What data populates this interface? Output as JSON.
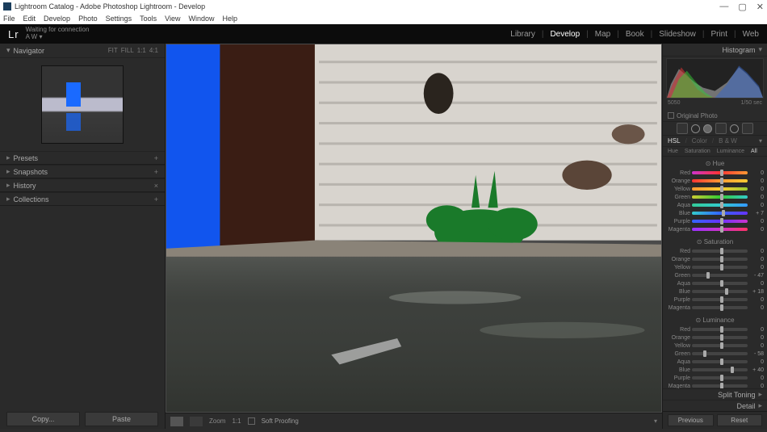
{
  "titlebar": {
    "title": "Lightroom Catalog - Adobe Photoshop Lightroom - Develop"
  },
  "menubar": [
    "File",
    "Edit",
    "Develop",
    "Photo",
    "Settings",
    "Tools",
    "View",
    "Window",
    "Help"
  ],
  "header": {
    "lr": "Lr",
    "status": "Waiting for connection",
    "user": "A W ▾",
    "modules": [
      "Library",
      "Develop",
      "Map",
      "Book",
      "Slideshow",
      "Print",
      "Web"
    ],
    "active": "Develop"
  },
  "left": {
    "navigator": {
      "label": "Navigator",
      "fit": "FIT",
      "fill": "FILL",
      "z1": "1:1",
      "z2": "4:1"
    },
    "panels": [
      {
        "label": "Presets",
        "icon": "+"
      },
      {
        "label": "Snapshots",
        "icon": "+"
      },
      {
        "label": "History",
        "icon": "×"
      },
      {
        "label": "Collections",
        "icon": "+"
      }
    ],
    "copy": "Copy...",
    "paste": "Paste"
  },
  "center": {
    "zoom_label": "Zoom",
    "zoom_val": "1:1",
    "soft": "Soft Proofing"
  },
  "right": {
    "histogram": {
      "label": "Histogram",
      "iso": "5050",
      "shutter": "1/50 sec"
    },
    "original": "Original Photo",
    "hsl": {
      "tabs": [
        "HSL",
        "Color",
        "B & W"
      ],
      "active": "HSL",
      "subtabs": [
        "Hue",
        "Saturation",
        "Luminance",
        "All"
      ],
      "subactive": "All"
    },
    "colors": [
      "Red",
      "Orange",
      "Yellow",
      "Green",
      "Aqua",
      "Blue",
      "Purple",
      "Magenta"
    ],
    "groups": [
      {
        "title": "Hue",
        "vals": [
          0,
          0,
          0,
          0,
          0,
          7,
          0,
          0
        ],
        "hue": true
      },
      {
        "title": "Saturation",
        "vals": [
          0,
          0,
          0,
          -47,
          0,
          18,
          0,
          0
        ]
      },
      {
        "title": "Luminance",
        "vals": [
          0,
          0,
          0,
          -58,
          0,
          40,
          0,
          0
        ]
      }
    ],
    "split": "Split Toning",
    "detail": "Detail",
    "previous": "Previous",
    "reset": "Reset"
  }
}
